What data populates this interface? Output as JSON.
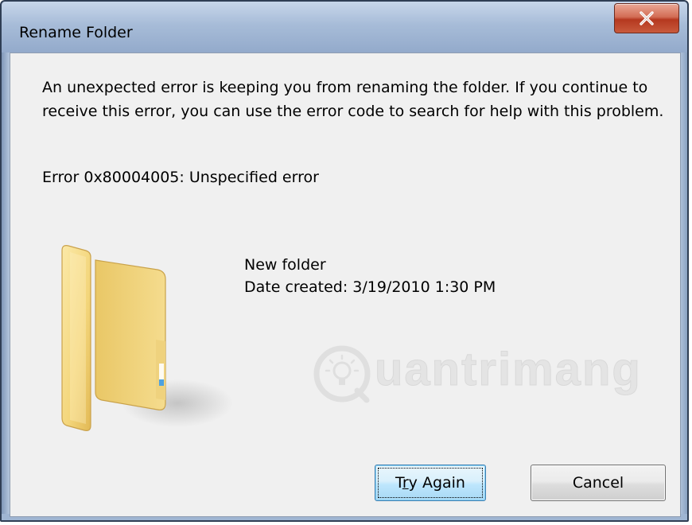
{
  "window": {
    "title": "Rename Folder"
  },
  "dialog": {
    "message": "An unexpected error is keeping you from renaming the folder. If you continue to receive this error, you can use the error code to search for help with this problem.",
    "error_code": "Error 0x80004005: Unspecified error",
    "folder": {
      "name": "New folder",
      "date_created": "Date created: 3/19/2010 1:30 PM",
      "icon": "folder-icon"
    },
    "watermark": {
      "text": "uantrimang",
      "logo_icon": "lightbulb-q-logo"
    }
  },
  "buttons": {
    "try_again_prefix": "T",
    "try_again_mnemonic": "r",
    "try_again_suffix": "y Again",
    "cancel": "Cancel",
    "close_icon": "close-icon"
  },
  "colors": {
    "close_button": "#c85a3c",
    "primary_button_border": "#3c7fb1",
    "dialog_background": "#f0f0f0",
    "folder_yellow": "#f3d57a"
  }
}
